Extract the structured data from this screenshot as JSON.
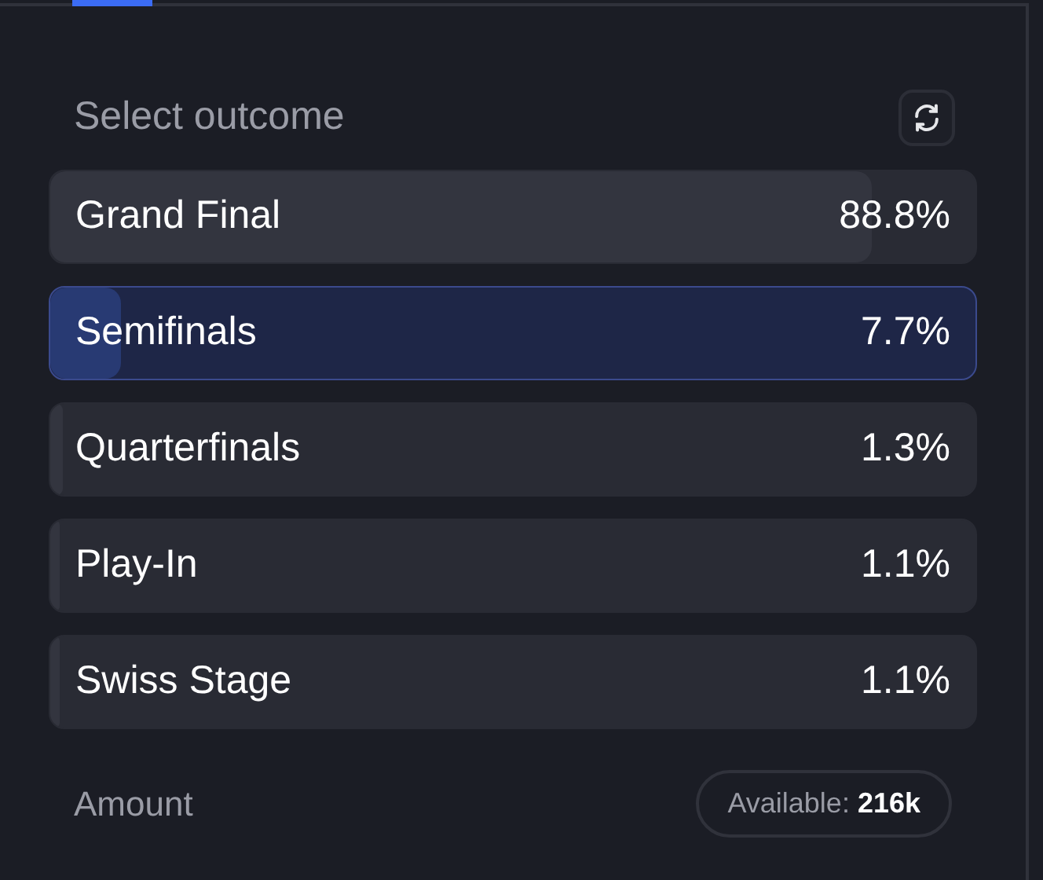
{
  "header": {
    "title": "Select outcome"
  },
  "outcomes": [
    {
      "label": "Grand Final",
      "value": "88.8%",
      "level": 0.888,
      "selected": false
    },
    {
      "label": "Semifinals",
      "value": "7.7%",
      "level": 0.077,
      "selected": true
    },
    {
      "label": "Quarterfinals",
      "value": "1.3%",
      "level": 0.013,
      "selected": false
    },
    {
      "label": "Play-In",
      "value": "1.1%",
      "level": 0.011,
      "selected": false
    },
    {
      "label": "Swiss Stage",
      "value": "1.1%",
      "level": 0.011,
      "selected": false
    }
  ],
  "amount": {
    "label": "Amount",
    "available": "Available: **216k**"
  }
}
